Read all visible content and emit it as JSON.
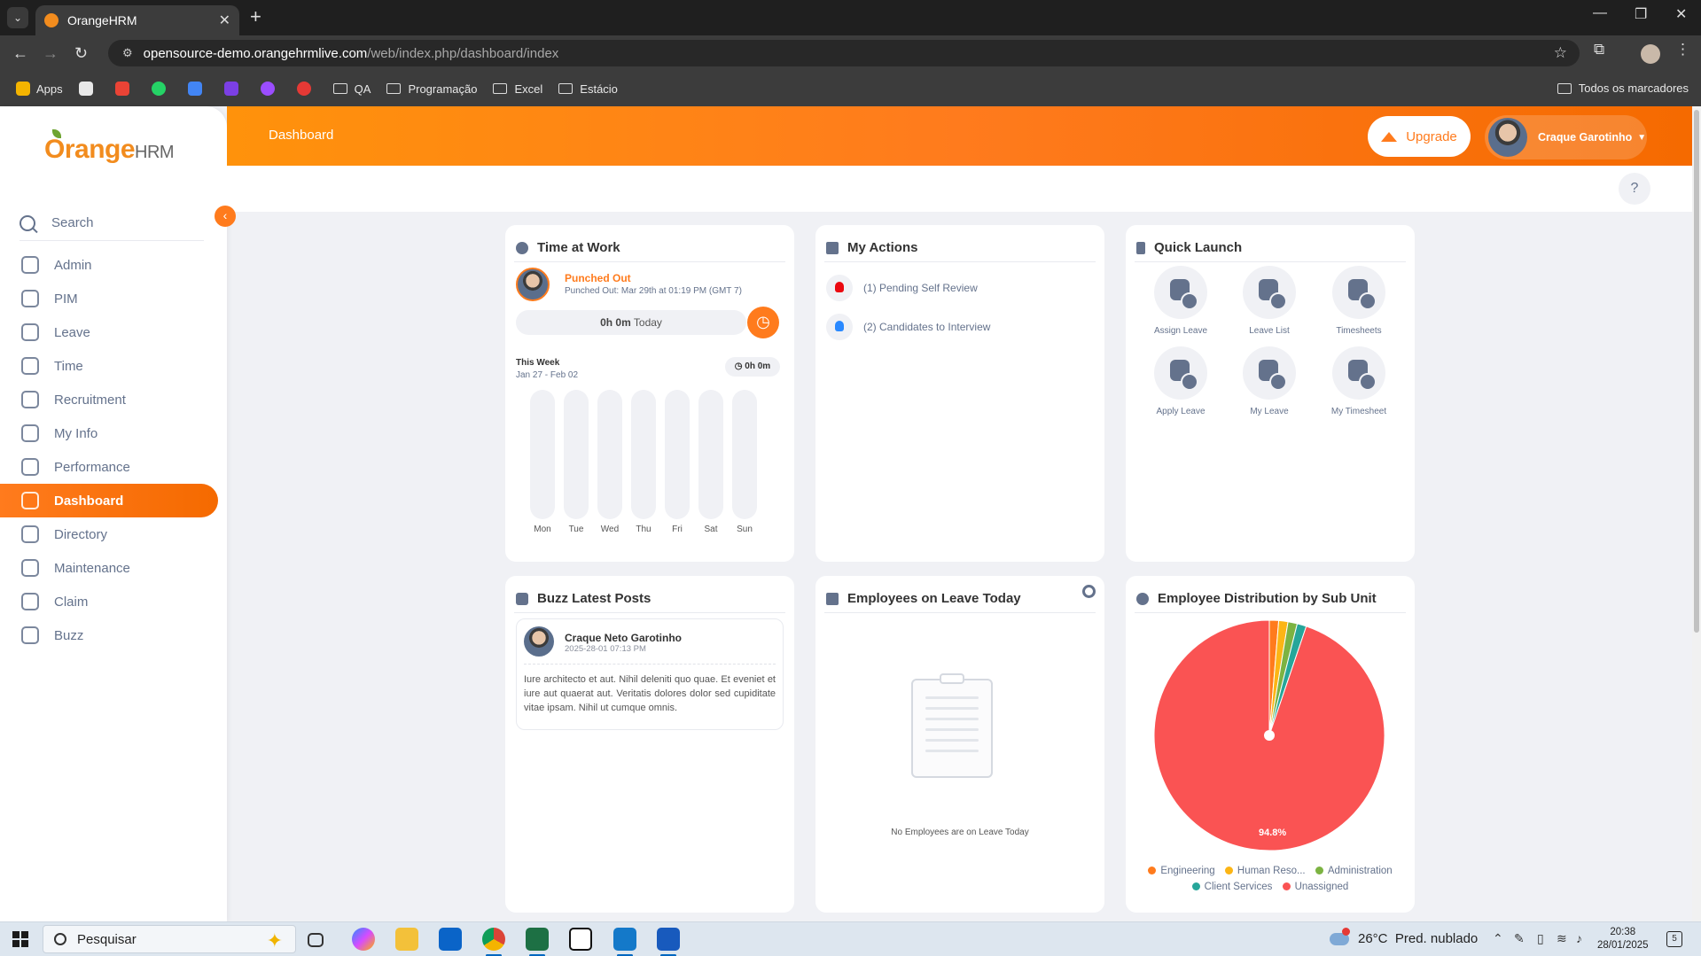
{
  "browser": {
    "tab_title": "OrangeHRM",
    "url_host": "opensource-demo.orangehrmlive.com",
    "url_path": "/web/index.php/dashboard/index",
    "bookmarks": [
      {
        "label": "Apps",
        "color": "#f4b400"
      },
      {
        "label": "",
        "color": "#e8e8e8"
      },
      {
        "label": "",
        "color": "#ea4335"
      },
      {
        "label": "",
        "color": "#25d366"
      },
      {
        "label": "",
        "color": "#4285f4"
      },
      {
        "label": "",
        "color": "#7b3fe4"
      },
      {
        "label": "",
        "color": "#9b4dff"
      },
      {
        "label": "",
        "color": "#e53935"
      }
    ],
    "bookmark_folders": [
      "QA",
      "Programação",
      "Excel",
      "Estácio"
    ],
    "all_bookmarks": "Todos os marcadores"
  },
  "sidebar": {
    "logo_orange": "Orange",
    "logo_hrm": "HRM",
    "search_label": "Search",
    "items": [
      {
        "label": "Admin"
      },
      {
        "label": "PIM"
      },
      {
        "label": "Leave"
      },
      {
        "label": "Time"
      },
      {
        "label": "Recruitment"
      },
      {
        "label": "My Info"
      },
      {
        "label": "Performance"
      },
      {
        "label": "Dashboard",
        "active": true
      },
      {
        "label": "Directory"
      },
      {
        "label": "Maintenance"
      },
      {
        "label": "Claim"
      },
      {
        "label": "Buzz"
      }
    ]
  },
  "topbar": {
    "breadcrumb": "Dashboard",
    "upgrade_label": "Upgrade",
    "user_name": "Craque Garotinho",
    "help": "?"
  },
  "time_at_work": {
    "title": "Time at Work",
    "status": "Punched Out",
    "punch_detail": "Punched Out: Mar 29th at 01:19 PM (GMT 7)",
    "today_value": "0h 0m",
    "today_label": "Today",
    "week_label": "This Week",
    "week_range": "Jan 27 - Feb 02",
    "week_total": "0h 0m",
    "days": [
      "Mon",
      "Tue",
      "Wed",
      "Thu",
      "Fri",
      "Sat",
      "Sun"
    ]
  },
  "my_actions": {
    "title": "My Actions",
    "items": [
      {
        "label": "(1) Pending Self Review"
      },
      {
        "label": "(2) Candidates to Interview"
      }
    ]
  },
  "quick_launch": {
    "title": "Quick Launch",
    "items": [
      {
        "label": "Assign Leave"
      },
      {
        "label": "Leave List"
      },
      {
        "label": "Timesheets"
      },
      {
        "label": "Apply Leave"
      },
      {
        "label": "My Leave"
      },
      {
        "label": "My Timesheet"
      }
    ]
  },
  "buzz": {
    "title": "Buzz Latest Posts",
    "author": "Craque Neto Garotinho",
    "date": "2025-28-01 07:13 PM",
    "text": "Iure architecto et aut. Nihil deleniti quo quae. Et eveniet et iure aut quaerat aut. Veritatis dolores dolor sed cupiditate vitae ipsam. Nihil ut cumque omnis."
  },
  "leave_today": {
    "title": "Employees on Leave Today",
    "empty_text": "No Employees are on Leave Today"
  },
  "distribution": {
    "title": "Employee Distribution by Sub Unit",
    "center_label": "94.8%",
    "legend": [
      {
        "label": "Engineering",
        "color": "#ff7b1d"
      },
      {
        "label": "Human Reso...",
        "color": "#fcb515"
      },
      {
        "label": "Administration",
        "color": "#7cb342"
      },
      {
        "label": "Client Services",
        "color": "#26a69a"
      },
      {
        "label": "Unassigned",
        "color": "#fa5353"
      }
    ]
  },
  "chart_data": {
    "type": "pie",
    "categories": [
      "Engineering",
      "Human Reso...",
      "Administration",
      "Client Services",
      "Unassigned"
    ],
    "values": [
      1.3,
      1.3,
      1.3,
      1.3,
      94.8
    ],
    "colors": [
      "#ff7b1d",
      "#fcb515",
      "#7cb342",
      "#26a69a",
      "#fa5353"
    ],
    "title": "Employee Distribution by Sub Unit",
    "legend_position": "bottom"
  },
  "taskbar": {
    "search_placeholder": "Pesquisar",
    "weather_temp": "26°C",
    "weather_desc": "Pred. nublado",
    "time": "20:38",
    "date": "28/01/2025",
    "notif_count": "5"
  }
}
